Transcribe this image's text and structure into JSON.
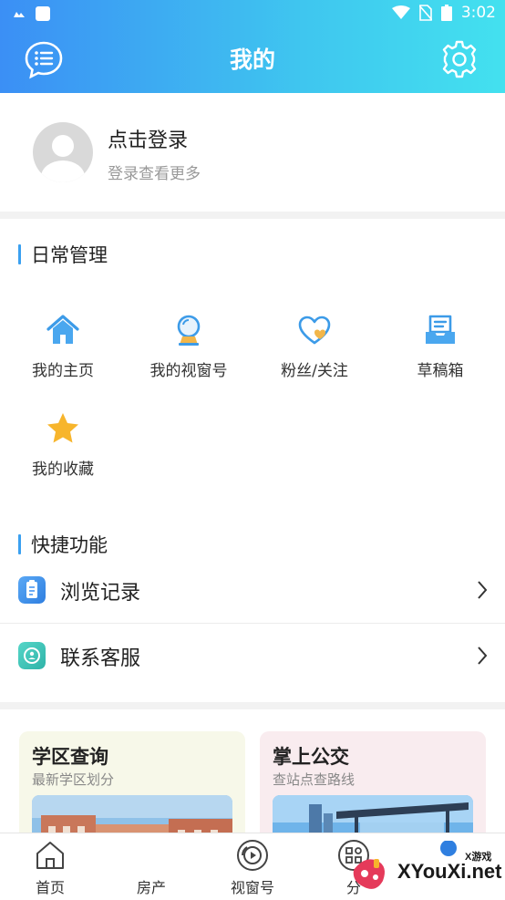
{
  "status_bar": {
    "time": "3:02"
  },
  "header": {
    "title": "我的",
    "message_icon": "message-list-icon",
    "settings_icon": "gear-icon"
  },
  "profile": {
    "login_title": "点击登录",
    "login_subtitle": "登录查看更多"
  },
  "daily": {
    "title": "日常管理",
    "items": [
      {
        "label": "我的主页",
        "icon": "home-icon"
      },
      {
        "label": "我的视窗号",
        "icon": "crystal-ball-icon"
      },
      {
        "label": "粉丝/关注",
        "icon": "heart-icon"
      },
      {
        "label": "草稿箱",
        "icon": "drafts-icon"
      },
      {
        "label": "我的收藏",
        "icon": "star-icon"
      }
    ]
  },
  "quick": {
    "title": "快捷功能",
    "items": [
      {
        "label": "浏览记录",
        "icon": "history-icon"
      },
      {
        "label": "联系客服",
        "icon": "customer-service-icon"
      }
    ]
  },
  "cards": [
    {
      "title": "学区查询",
      "subtitle": "最新学区划分"
    },
    {
      "title": "掌上公交",
      "subtitle": "查站点查路线"
    }
  ],
  "tabbar": {
    "tabs": [
      {
        "label": "首页",
        "icon": "home-outline-icon"
      },
      {
        "label": "房产",
        "icon": ""
      },
      {
        "label": "视窗号",
        "icon": "video-window-icon"
      },
      {
        "label": "分",
        "icon": "category-icon"
      }
    ]
  },
  "watermark": {
    "text": "XYouXi.net",
    "small": "X游戏"
  },
  "colors": {
    "header_start": "#3b8ff5",
    "header_end": "#43e1ef",
    "accent": "#3aa0f0",
    "star": "#f7b52c"
  }
}
